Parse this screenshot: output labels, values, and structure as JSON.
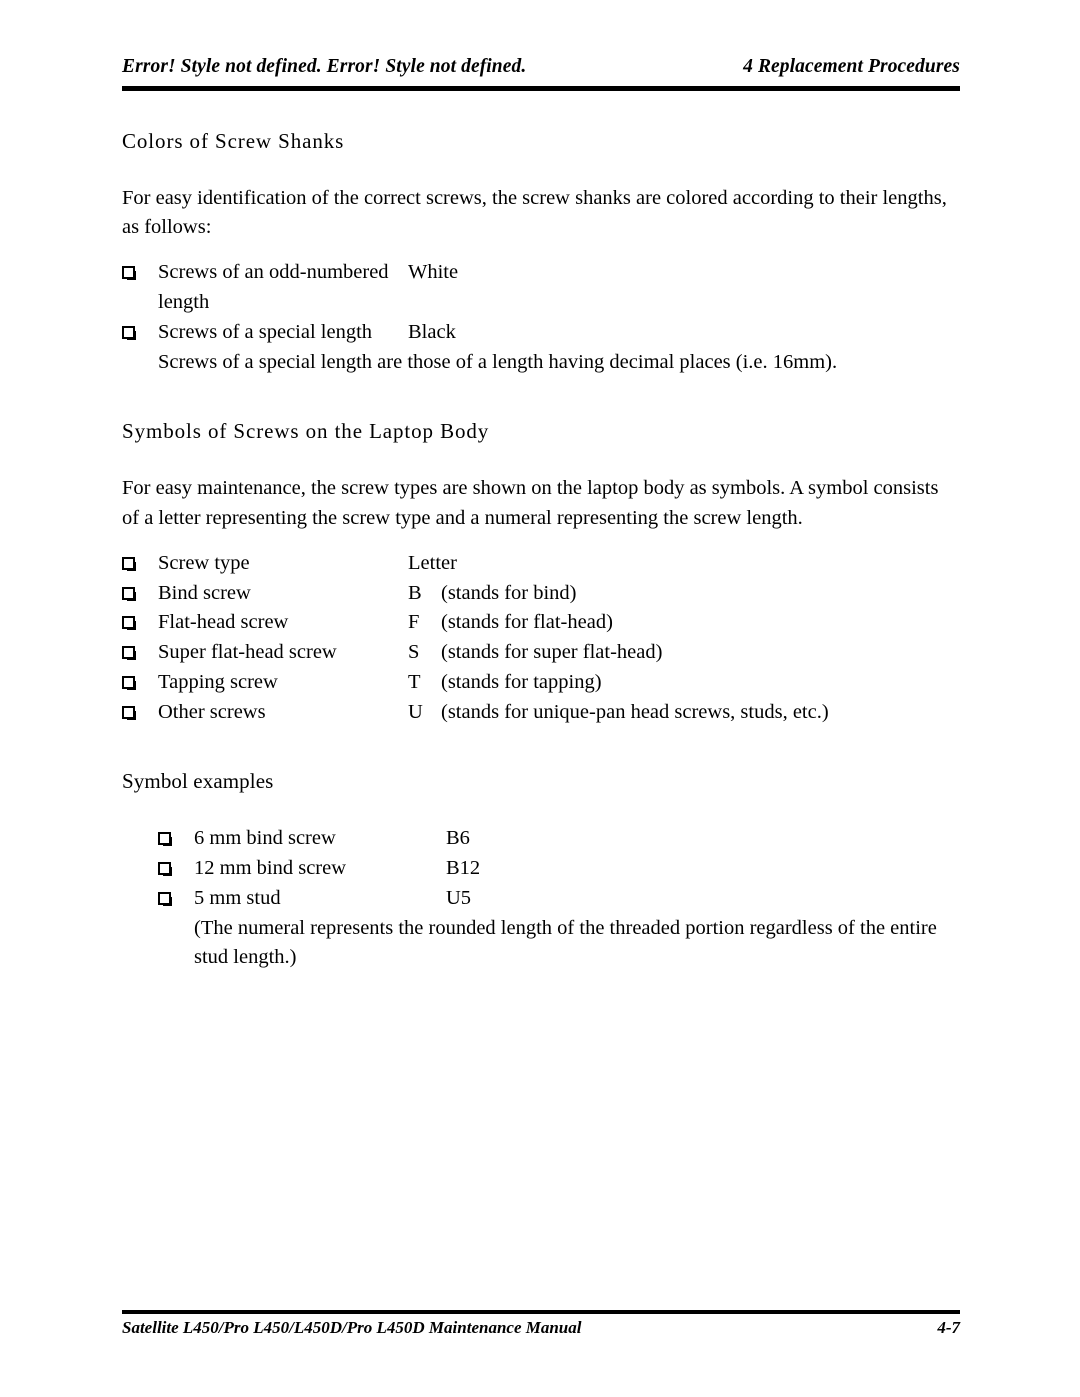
{
  "header": {
    "left_text": "Error! Style not defined. Error! Style not defined.",
    "right_text": "4 Replacement Procedures"
  },
  "footer": {
    "left_text": "Satellite L450/Pro L450/L450D/Pro L450D Maintenance Manual",
    "page_number": "4-7"
  },
  "sections": {
    "colors": {
      "heading": "Colors of Screw Shanks",
      "intro": "For easy identification of the correct screws, the screw shanks are colored according to their lengths, as follows:",
      "rows": [
        {
          "label": "Screws of an odd-numbered length",
          "value": "White"
        },
        {
          "label": "Screws of a special length",
          "value": "Black"
        }
      ],
      "note": "Screws of a special length are those of a length having decimal places (i.e. 16mm)."
    },
    "symbols": {
      "heading": "Symbols of Screws on the Laptop Body",
      "intro": "For easy maintenance, the screw types are shown on the laptop body as symbols. A symbol consists of a letter representing the screw type and a numeral representing the screw length.",
      "rows": [
        {
          "label": "Screw type",
          "letter": "Letter",
          "desc": ""
        },
        {
          "label": "Bind screw",
          "letter": "B",
          "desc": "(stands for bind)"
        },
        {
          "label": "Flat-head screw",
          "letter": "F",
          "desc": "(stands for flat-head)"
        },
        {
          "label": "Super flat-head screw",
          "letter": "S",
          "desc": "(stands for super flat-head)"
        },
        {
          "label": "Tapping screw",
          "letter": "T",
          "desc": "(stands for tapping)"
        },
        {
          "label": "Other screws",
          "letter": "U",
          "desc": "(stands for unique-pan head screws, studs, etc.)"
        }
      ]
    },
    "examples": {
      "heading": "Symbol examples",
      "rows": [
        {
          "label": "6 mm bind screw",
          "value": "B6"
        },
        {
          "label": "12 mm bind screw",
          "value": "B12"
        },
        {
          "label": "5 mm stud",
          "value": "U5"
        }
      ],
      "note": "(The numeral represents the rounded length of the threaded portion regardless of the entire stud length.)"
    }
  },
  "icons": {
    "bullet": "shadowed-white-square"
  },
  "colors": {
    "text": "#000000",
    "rule": "#000000",
    "background": "#ffffff"
  }
}
